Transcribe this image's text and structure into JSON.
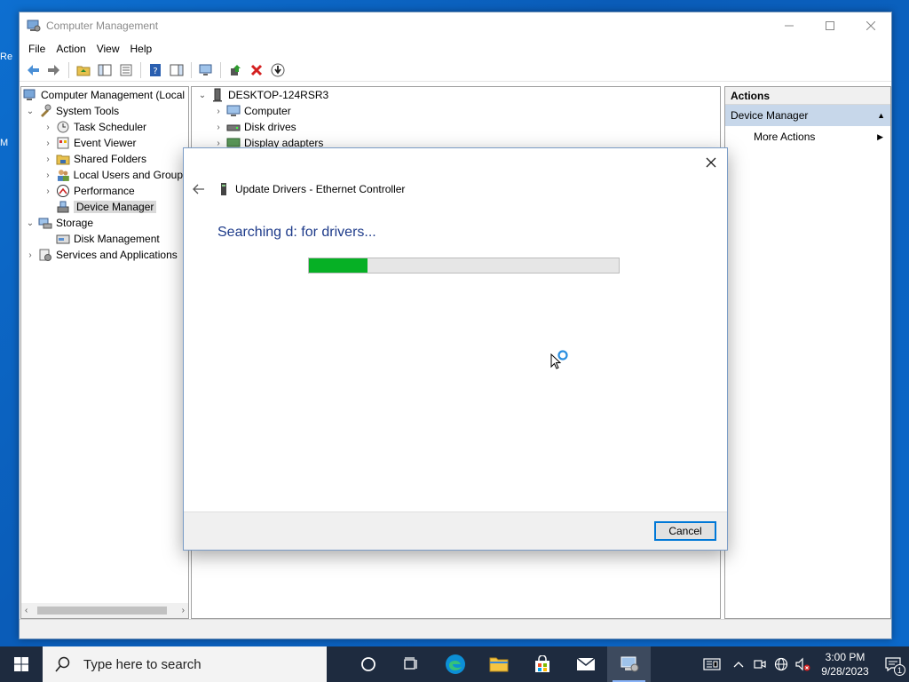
{
  "window": {
    "title": "Computer Management",
    "menu": [
      "File",
      "Action",
      "View",
      "Help"
    ]
  },
  "tree": {
    "root": "Computer Management (Local",
    "items": [
      {
        "label": "System Tools"
      },
      {
        "label": "Task Scheduler"
      },
      {
        "label": "Event Viewer"
      },
      {
        "label": "Shared Folders"
      },
      {
        "label": "Local Users and Groups"
      },
      {
        "label": "Performance"
      },
      {
        "label": "Device Manager"
      },
      {
        "label": "Storage"
      },
      {
        "label": "Disk Management"
      },
      {
        "label": "Services and Applications"
      }
    ]
  },
  "center": {
    "computer_name": "DESKTOP-124RSR3",
    "categories": [
      "Computer",
      "Disk drives",
      "Display adapters"
    ]
  },
  "actions": {
    "heading": "Actions",
    "section": "Device Manager",
    "more": "More Actions"
  },
  "dialog": {
    "title": "Update Drivers - Ethernet Controller",
    "status": "Searching d: for drivers...",
    "progress_percent": 19,
    "cancel_label": "Cancel"
  },
  "taskbar": {
    "search_placeholder": "Type here to search",
    "time": "3:00 PM",
    "date": "9/28/2023",
    "notification_count": "1"
  },
  "colors": {
    "progress_fill": "#06b025",
    "accent": "#0078d7",
    "status_text": "#1e3b8a"
  }
}
